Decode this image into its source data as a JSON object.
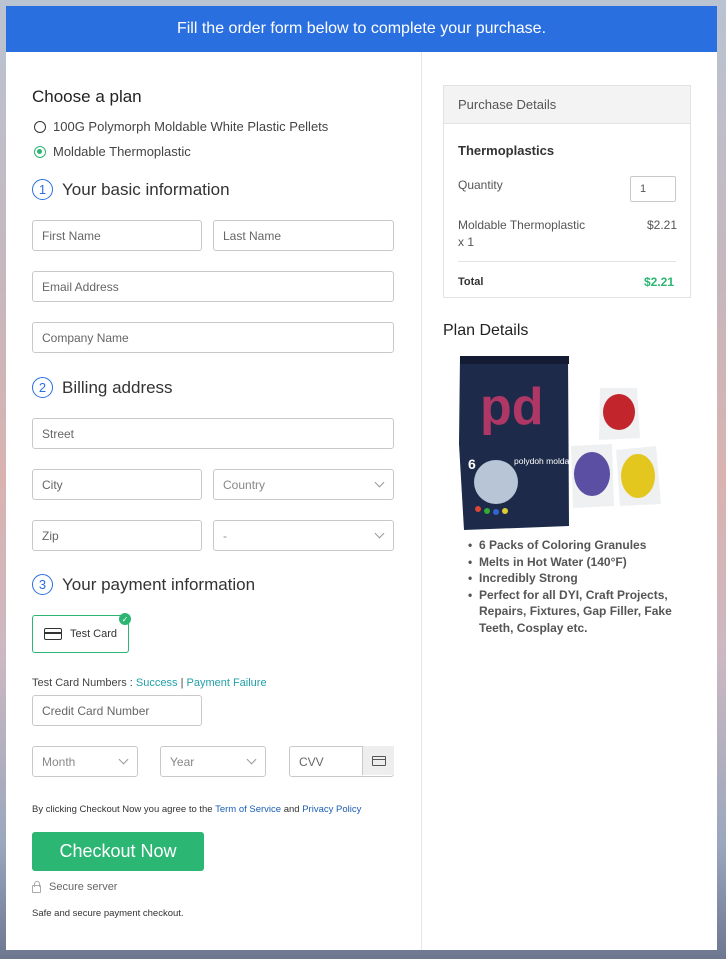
{
  "banner": {
    "text": "Fill the order form below to complete your purchase."
  },
  "plan": {
    "title": "Choose a plan",
    "options": [
      {
        "label": "100G Polymorph Moldable White Plastic Pellets",
        "selected": false
      },
      {
        "label": "Moldable Thermoplastic",
        "selected": true
      }
    ]
  },
  "basic_info": {
    "step": "1",
    "title": "Your basic information",
    "first_name_placeholder": "First Name",
    "last_name_placeholder": "Last Name",
    "email_placeholder": "Email Address",
    "company_placeholder": "Company Name"
  },
  "billing": {
    "step": "2",
    "title": "Billing address",
    "street_placeholder": "Street",
    "city_placeholder": "City",
    "country_placeholder": "Country",
    "zip_placeholder": "Zip",
    "state_placeholder": "-"
  },
  "payment": {
    "step": "3",
    "title": "Your payment information",
    "test_card_label": "Test Card",
    "test_numbers_label": "Test Card Numbers : ",
    "success_link": "Success",
    "separator": "|",
    "failure_link": "Payment Failure",
    "card_number_placeholder": "Credit Card Number",
    "month_placeholder": "Month",
    "year_placeholder": "Year",
    "cvv_placeholder": "CVV"
  },
  "agreement": {
    "prefix": "By clicking Checkout Now you agree to the ",
    "terms_link": "Term of Service",
    "middle": " and ",
    "privacy_link": "Privacy Policy"
  },
  "checkout": {
    "button_label": "Checkout Now"
  },
  "secure": {
    "label": "Secure server",
    "note": "Safe and secure payment checkout."
  },
  "purchase_details": {
    "title": "Purchase Details",
    "product_name": "Thermoplastics",
    "quantity_label": "Quantity",
    "quantity_value": "1",
    "line_item_name": "Moldable Thermoplastic",
    "line_item_qty": "x 1",
    "line_item_price": "$2.21",
    "total_label": "Total",
    "total_value": "$2.21"
  },
  "plan_details": {
    "title": "Plan Details",
    "bag_brand": "polydoh moldable plastic",
    "bag_count": "6",
    "bullets": [
      "6 Packs of Coloring Granules",
      "Melts in Hot Water (140°F)",
      "Incredibly Strong",
      "Perfect for all DYI, Craft Projects, Repairs, Fixtures, Gap Filler, Fake Teeth, Cosplay etc."
    ]
  },
  "colors": {
    "accent_blue": "#2a6fe0",
    "accent_green": "#2bb673"
  }
}
